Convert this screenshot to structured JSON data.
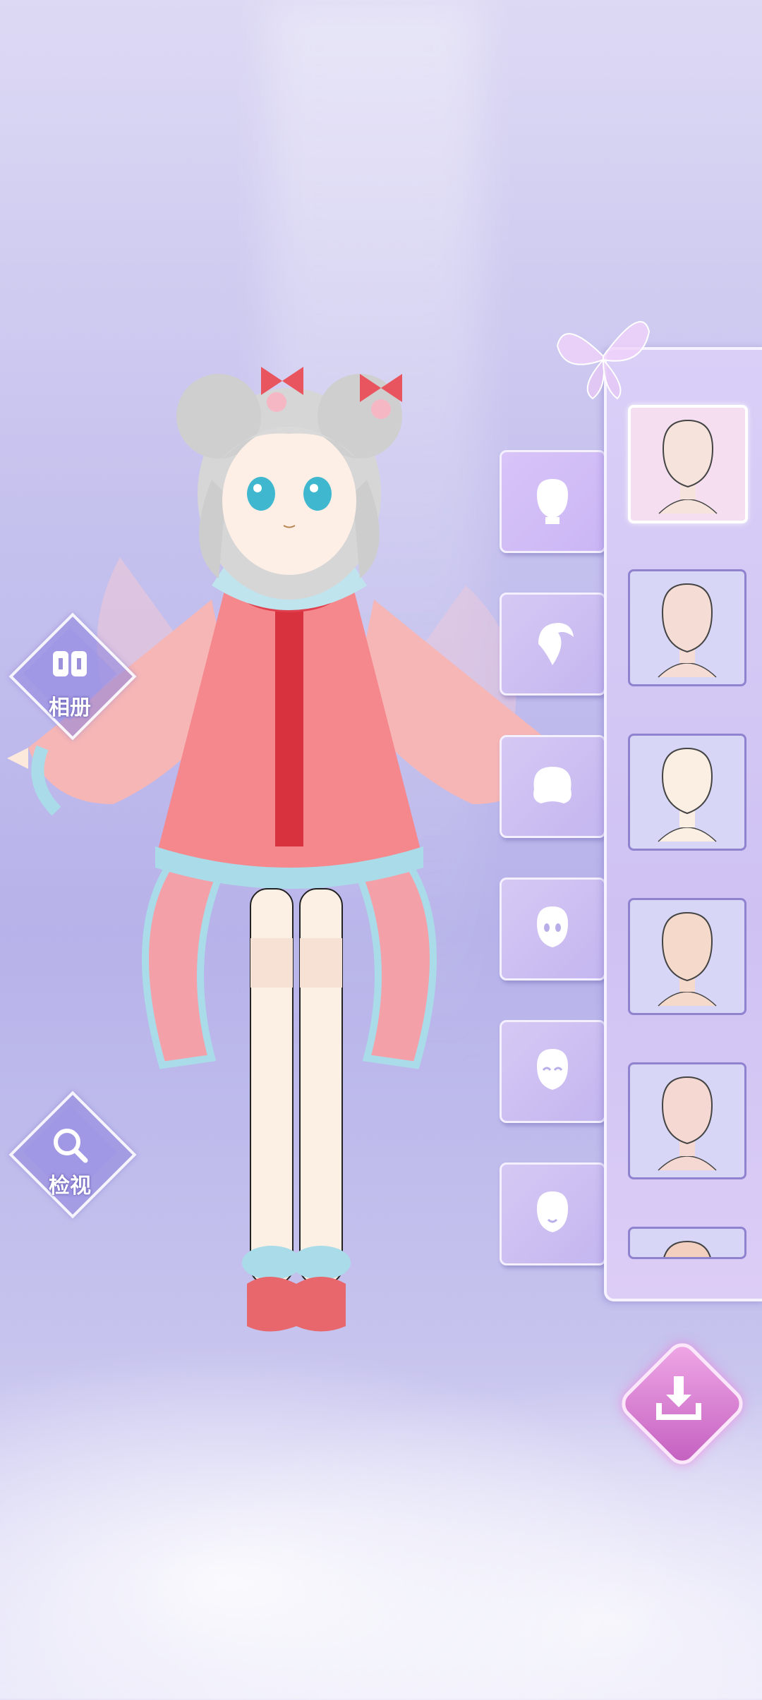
{
  "side_buttons": {
    "album_label": "相册",
    "inspect_label": "检视"
  },
  "categories": [
    {
      "name": "face-shape",
      "selected": true
    },
    {
      "name": "bangs"
    },
    {
      "name": "back-hair"
    },
    {
      "name": "eyes"
    },
    {
      "name": "expression-smile"
    },
    {
      "name": "mouth"
    }
  ],
  "options": [
    {
      "skin": "#f6e3dc",
      "selected": true
    },
    {
      "skin": "#f5dcd5"
    },
    {
      "skin": "#fbeee2"
    },
    {
      "skin": "#f5dacb"
    },
    {
      "skin": "#f6d8d2"
    },
    {
      "skin": "#f2cfbf",
      "partial": true
    }
  ],
  "colors": {
    "accent": "#c35fc0",
    "panel_border": "#8f82cf",
    "background": "#c9c5ef"
  }
}
